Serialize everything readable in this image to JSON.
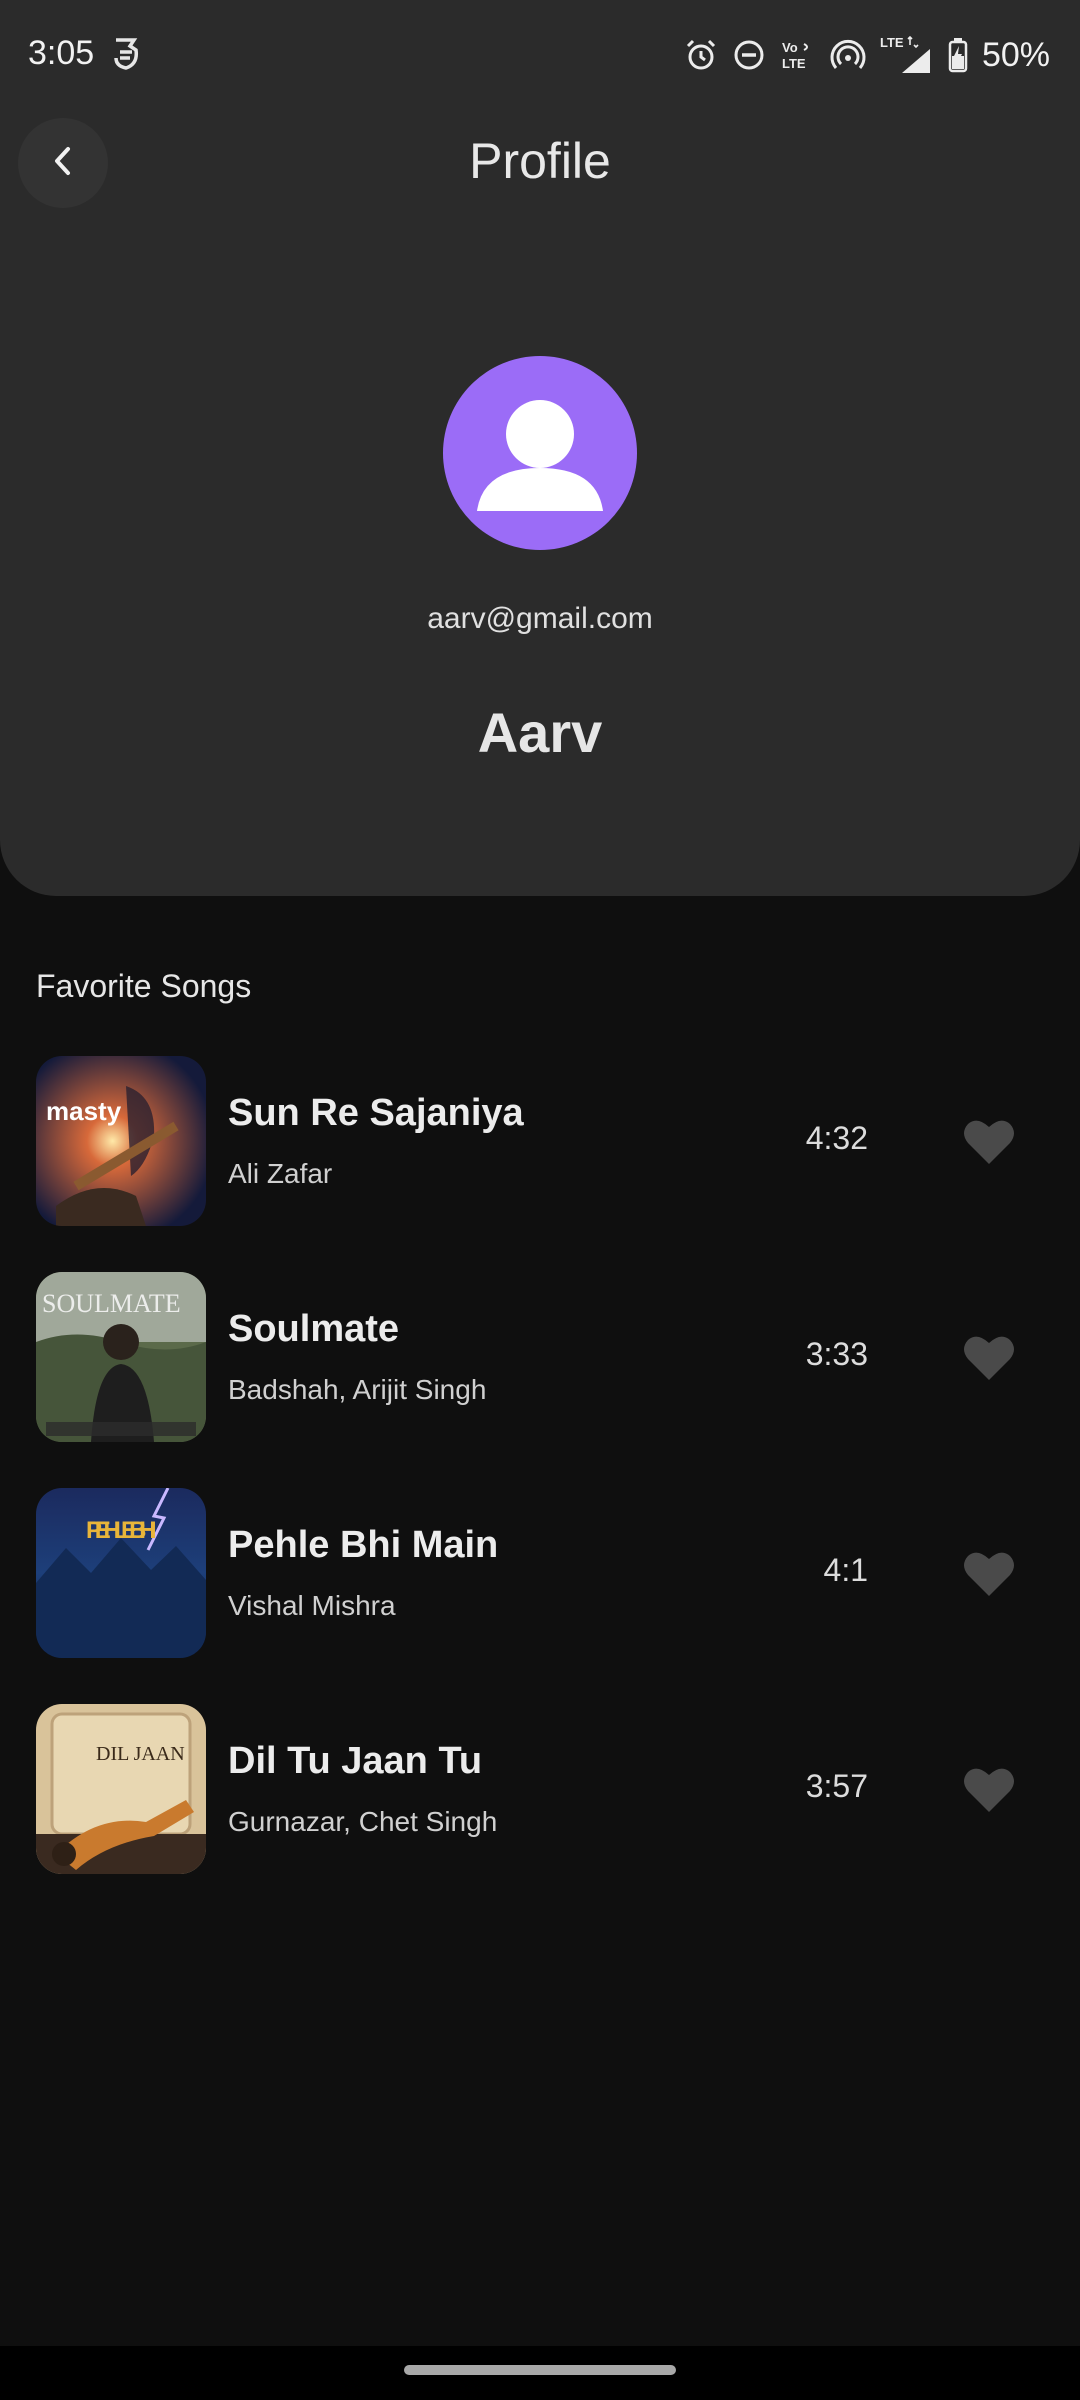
{
  "status_bar": {
    "time": "3:05",
    "battery": "50%",
    "icons": [
      "alarm-icon",
      "dnd-icon",
      "volte-icon",
      "hotspot-icon",
      "lte-signal-icon",
      "battery-charging-icon"
    ]
  },
  "header": {
    "title": "Profile",
    "back_icon": "chevron-left-icon"
  },
  "profile": {
    "email": "aarv@gmail.com",
    "name": "Aarv",
    "avatar_color": "#9b6cf7"
  },
  "favorites": {
    "title": "Favorite Songs",
    "songs": [
      {
        "title": "Sun Re Sajaniya",
        "artist": "Ali Zafar",
        "duration": "4:32",
        "art_text": "masty"
      },
      {
        "title": "Soulmate",
        "artist": "Badshah, Arijit Singh",
        "duration": "3:33",
        "art_text": "SOULMATE"
      },
      {
        "title": "Pehle Bhi Main",
        "artist": "Vishal Mishra",
        "duration": "4:1",
        "art_text": "PEHLE BHI"
      },
      {
        "title": "Dil Tu Jaan Tu",
        "artist": "Gurnazar, Chet Singh",
        "duration": "3:57",
        "art_text": "DIL JAAN"
      }
    ]
  },
  "colors": {
    "background": "#0f0f0f",
    "card": "#2b2b2b",
    "accent": "#9b6cf7",
    "heart": "#4a4a4a"
  }
}
